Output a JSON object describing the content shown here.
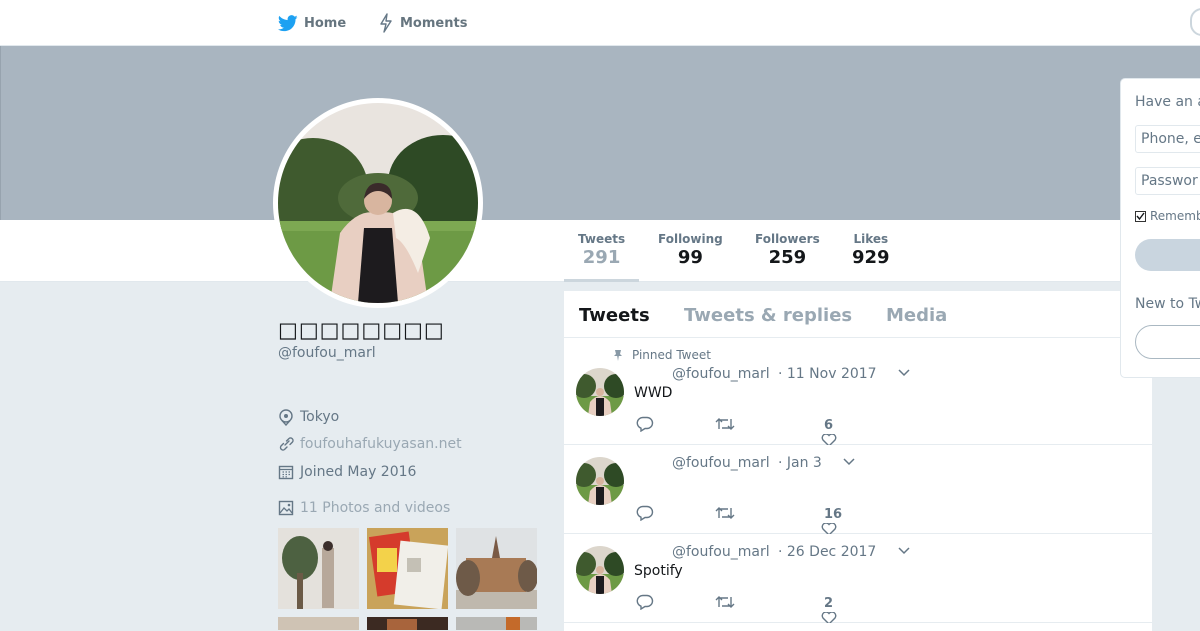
{
  "nav": {
    "home_label": "Home",
    "moments_label": "Moments"
  },
  "stats": [
    {
      "label": "Tweets",
      "value": "291"
    },
    {
      "label": "Following",
      "value": "99"
    },
    {
      "label": "Followers",
      "value": "259"
    },
    {
      "label": "Likes",
      "value": "929"
    }
  ],
  "profile": {
    "name": "□□□□□□□□",
    "handle": "@foufou_marl",
    "location": "Tokyo",
    "url": "foufouhafukuyasan.net",
    "joined": "Joined May 2016",
    "photos_label": "11 Photos and videos"
  },
  "tabs": [
    "Tweets",
    "Tweets & replies",
    "Media"
  ],
  "tweets": [
    {
      "pinned_label": "Pinned Tweet",
      "handle": "@foufou_marl",
      "date": "· 11 Nov 2017",
      "text": "WWD",
      "likes": "6"
    },
    {
      "handle": "@foufou_marl",
      "date": "· Jan 3",
      "text": "",
      "likes": "16"
    },
    {
      "handle": "@foufou_marl",
      "date": "· 26 Dec 2017",
      "text": "Spotify",
      "likes": "2"
    }
  ],
  "login": {
    "title": "Have an a",
    "phone_placeholder": "Phone, e",
    "password_placeholder": "Passwor",
    "remember_label": "Rememb",
    "new_to": "New to Tw"
  },
  "colors": {
    "brand": "#1da1f2",
    "banner": "#a9b5c0",
    "page_bg": "#e6ecf0"
  }
}
